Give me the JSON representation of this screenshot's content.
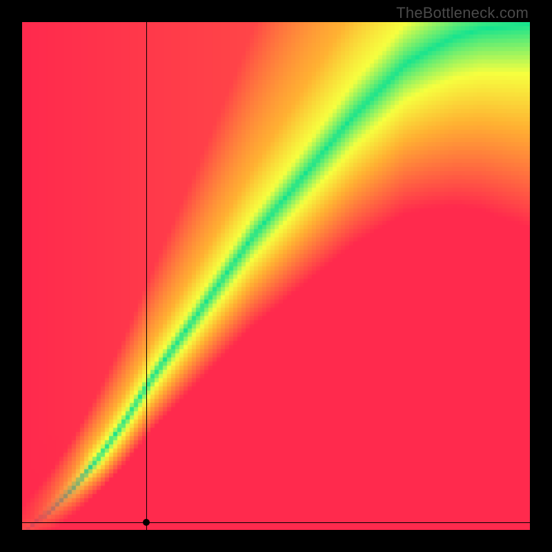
{
  "watermark": "TheBottleneck.com",
  "chart_data": {
    "type": "heatmap",
    "title": "",
    "xlabel": "",
    "ylabel": "",
    "xlim": [
      0,
      1
    ],
    "ylim": [
      0,
      1
    ],
    "legend": false,
    "description": "Bottleneck compatibility heatmap. Color encodes mismatch: green along an optimal diagonal ridge, fading through yellow/orange to red away from the ridge. A corridor of yellow surrounds the green ridge; the upper-right quadrant is broadly yellow/orange; the lower-right and upper-left regions are red.",
    "color_scale": {
      "optimal": "#15e38f",
      "good": "#f6ff3f",
      "moderate": "#ffb132",
      "poor": "#ff2a4d"
    },
    "ridge_points_norm": [
      {
        "x": 0.0,
        "y": 0.0
      },
      {
        "x": 0.05,
        "y": 0.04
      },
      {
        "x": 0.1,
        "y": 0.09
      },
      {
        "x": 0.15,
        "y": 0.15
      },
      {
        "x": 0.2,
        "y": 0.22
      },
      {
        "x": 0.25,
        "y": 0.3
      },
      {
        "x": 0.3,
        "y": 0.37
      },
      {
        "x": 0.35,
        "y": 0.44
      },
      {
        "x": 0.4,
        "y": 0.51
      },
      {
        "x": 0.45,
        "y": 0.58
      },
      {
        "x": 0.5,
        "y": 0.64
      },
      {
        "x": 0.55,
        "y": 0.7
      },
      {
        "x": 0.6,
        "y": 0.76
      },
      {
        "x": 0.65,
        "y": 0.82
      },
      {
        "x": 0.7,
        "y": 0.87
      },
      {
        "x": 0.75,
        "y": 0.92
      },
      {
        "x": 0.8,
        "y": 0.95
      },
      {
        "x": 0.85,
        "y": 0.975
      },
      {
        "x": 0.9,
        "y": 0.99
      },
      {
        "x": 1.0,
        "y": 1.0
      }
    ],
    "ridge_width_norm": [
      {
        "x": 0.0,
        "w": 0.01
      },
      {
        "x": 0.1,
        "w": 0.016
      },
      {
        "x": 0.2,
        "w": 0.024
      },
      {
        "x": 0.3,
        "w": 0.032
      },
      {
        "x": 0.5,
        "w": 0.048
      },
      {
        "x": 0.7,
        "w": 0.062
      },
      {
        "x": 0.9,
        "w": 0.075
      },
      {
        "x": 1.0,
        "w": 0.082
      }
    ],
    "crosshair_point_norm": {
      "x": 0.245,
      "y": 0.015
    },
    "marker_radius_px": 5
  }
}
